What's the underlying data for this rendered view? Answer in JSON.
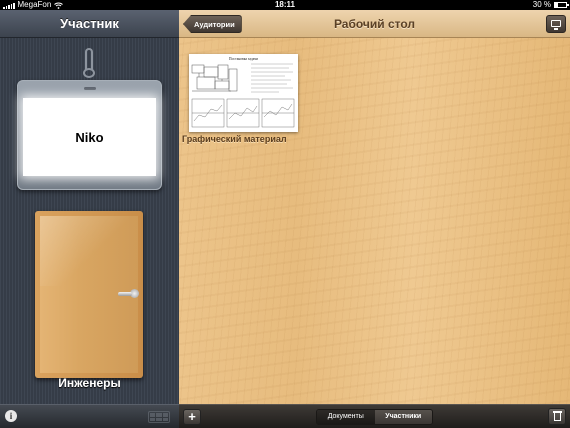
{
  "status": {
    "carrier": "MegaFon",
    "time": "18:11",
    "battery": "30 %",
    "battery_level": 0.3
  },
  "left_panel": {
    "title": "Участник",
    "badge_name": "Niko",
    "room_name": "Инженеры"
  },
  "main_panel": {
    "title": "Рабочий стол",
    "back_label": "Аудитории",
    "items": [
      {
        "thumb_title": "Постановка задачи",
        "label": "Графический материал"
      }
    ]
  },
  "bottom_bar": {
    "segments": [
      "Документы",
      "Участники"
    ],
    "selected_segment": "Участники",
    "info_glyph": "i",
    "add_glyph": "+"
  },
  "icons": {
    "signal": "signal-icon",
    "wifi": "wifi-icon",
    "battery": "battery-icon",
    "info": "info-icon",
    "grid": "grid-icon",
    "add": "plus-icon",
    "screen": "monitor-icon",
    "trash": "trash-icon"
  }
}
